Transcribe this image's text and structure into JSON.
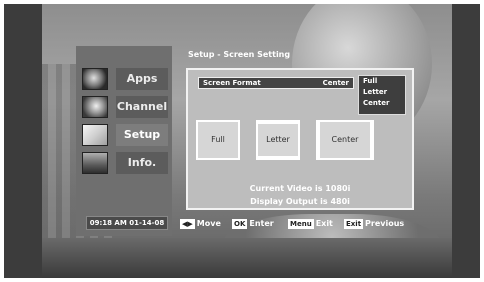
{
  "title": "Setup - Screen Setting",
  "nav": [
    {
      "label": "Apps",
      "active": false
    },
    {
      "label": "Channel",
      "active": false
    },
    {
      "label": "Setup",
      "active": true
    },
    {
      "label": "Info.",
      "active": false
    }
  ],
  "clock": "09:18 AM 01-14-08",
  "screen_format": {
    "label": "Screen Format",
    "value": "Center",
    "options": [
      "Full",
      "Letter",
      "Center"
    ]
  },
  "preview_options": [
    "Full",
    "Letter",
    "Center"
  ],
  "current_video": "Current Video is 1080i",
  "display_output": "Display Output is 480i",
  "footer": {
    "move_key": "◀▶",
    "move_label": "Move",
    "enter_key": "OK",
    "enter_label": "Enter",
    "exit_key": "Menu",
    "exit_label": "Exit",
    "previous_key": "Exit",
    "previous_label": "Previous"
  }
}
